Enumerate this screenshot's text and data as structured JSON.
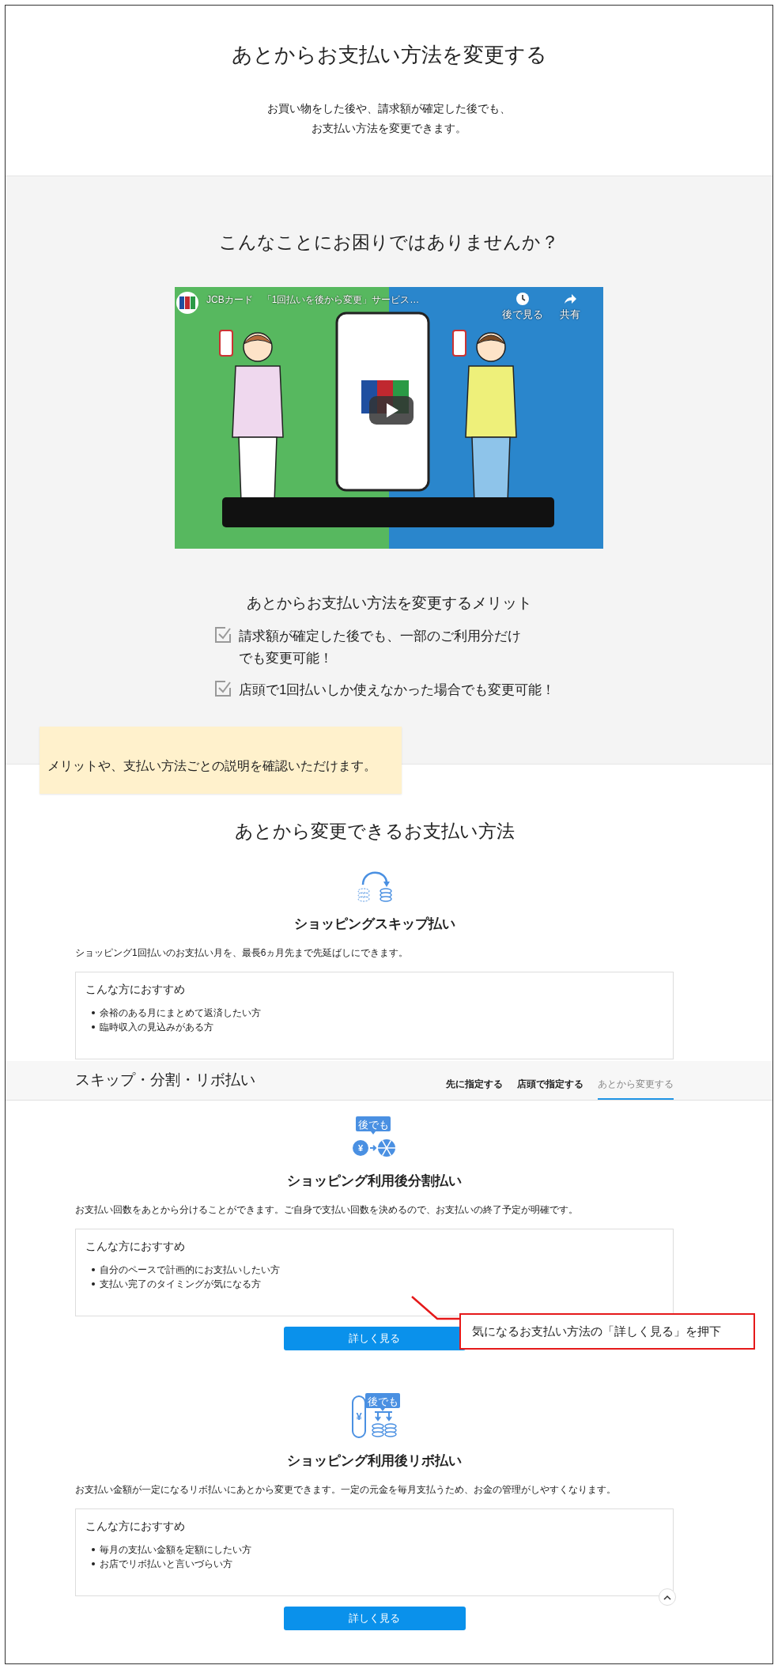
{
  "header": {
    "title": "あとからお支払い方法を変更する",
    "lines": [
      "お買い物をした後や、請求額が確定した後でも、",
      "お支払い方法を変更できます。"
    ]
  },
  "problem": {
    "title": "こんなことにお困りではありませんか？",
    "video": {
      "title": "JCBカード　「1回払いを後から変更」サービス…",
      "actions": [
        {
          "kind": "watch_later",
          "label": "後で見る"
        },
        {
          "kind": "share",
          "label": "共有"
        }
      ]
    },
    "merits": {
      "title": "あとからお支払い方法を変更するメリット",
      "items": [
        {
          "lines": [
            "請求額が確定した後でも、一部のご利用分だけ",
            "でも変更可能！"
          ],
          "checked": true
        },
        {
          "lines": [
            "店頭で1回払いしか使えなかった場合でも変更可能！"
          ],
          "checked": true
        }
      ]
    }
  },
  "note": "メリットや、支払い方法ごとの説明を確認いただけます。",
  "methods_section": {
    "title": "あとから変更できるお支払い方法",
    "methods": [
      {
        "kind": "skip",
        "title": "ショッピングスキップ払い",
        "description": "ショッピング1回払いのお支払い月を、最長6ヵ月先まで先延ばしにできます。",
        "recommend_title": "こんな方におすすめ",
        "recommend_items": [
          "余裕のある月にまとめて返済したい方",
          "臨時収入の見込みがある方"
        ]
      },
      {
        "kind": "split",
        "icon_badge": "後でも",
        "icon_symbol": "¥",
        "title": "ショッピング利用後分割払い",
        "description": "お支払い回数をあとから分けることができます。ご自身で支払い回数を決めるので、お支払いの終了予定が明確です。",
        "recommend_title": "こんな方におすすめ",
        "recommend_items": [
          "自分のペースで計画的にお支払いしたい方",
          "支払い完了のタイミングが気になる方"
        ],
        "button": "詳しく見る",
        "callout": "気になるお支払い方法の「詳しく見る」を押下"
      },
      {
        "kind": "revolving",
        "icon_badge": "後でも",
        "icon_symbol": "¥",
        "title": "ショッピング利用後リボ払い",
        "description": "お支払い金額が一定になるリボ払いにあとから変更できます。一定の元金を毎月支払うため、お金の管理がしやすくなります。",
        "recommend_title": "こんな方におすすめ",
        "recommend_items": [
          "毎月の支払い金額を定額にしたい方",
          "お店でリボ払いと言いづらい方"
        ],
        "button": "詳しく見る"
      }
    ]
  },
  "sticky_bar": {
    "title": "スキップ・分割・リボ払い",
    "tabs": [
      {
        "label": "先に指定する",
        "selected": false
      },
      {
        "label": "店頭で指定する",
        "selected": false
      },
      {
        "label": "あとから変更する",
        "selected": true
      }
    ]
  }
}
